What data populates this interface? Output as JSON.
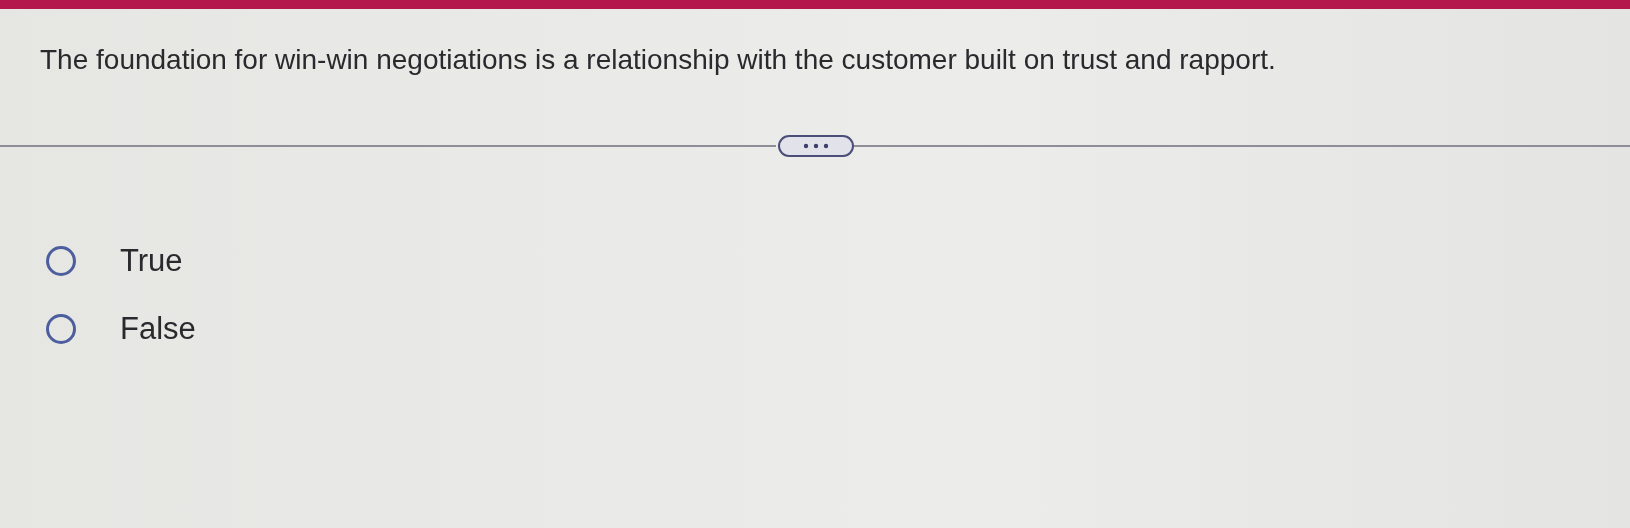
{
  "question": {
    "text": "The foundation for win-win negotiations is a relationship with the customer built on trust and rapport."
  },
  "options": [
    {
      "label": "True",
      "selected": false
    },
    {
      "label": "False",
      "selected": false
    }
  ]
}
